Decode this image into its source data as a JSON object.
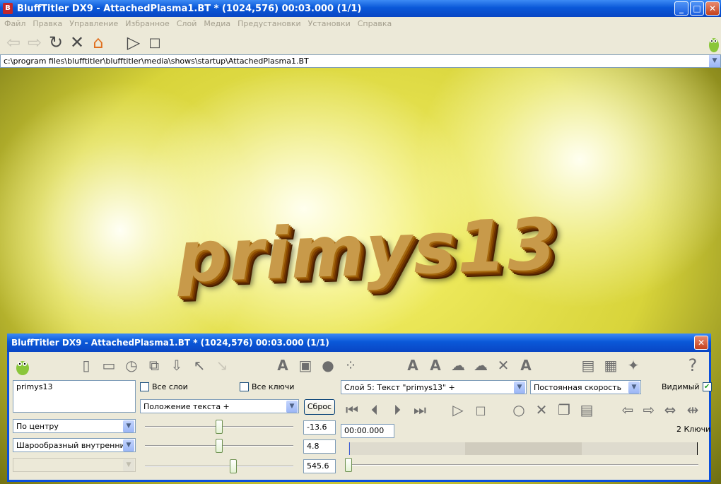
{
  "window": {
    "title": "BluffTitler DX9 - AttachedPlasma1.BT * (1024,576) 00:03.000 (1/1)"
  },
  "menu": [
    "Файл",
    "Правка",
    "Управление",
    "Избранное",
    "Слой",
    "Медиа",
    "Предустановки",
    "Установки",
    "Справка"
  ],
  "path": "c:\\program files\\blufftitler\\blufftitler\\media\\shows\\startup\\AttachedPlasma1.BT",
  "preview": {
    "text": "primys13"
  },
  "panel": {
    "title": "BluffTitler DX9 - AttachedPlasma1.BT * (1024,576) 00:03.000 (1/1)",
    "text_value": "primys13",
    "all_layers_label": "Все слои",
    "all_keys_label": "Все ключи",
    "property_select": "Положение текста +",
    "reset_label": "Сброс",
    "align_select": "По центру",
    "shape_select": "Шарообразный внутренний",
    "value1": "-13.6",
    "value2": "4.8",
    "value3": "545.6",
    "layer_select": "Слой 5: Текст \"primys13\" +",
    "speed_select": "Постоянная скорость",
    "visible_label": "Видимый",
    "time_value": "00:00.000",
    "keys_count": "2 Ключи",
    "slider_fracs": [
      0.5,
      0.5,
      0.6
    ]
  },
  "colors": {
    "titlebar": "#0a58d8",
    "accent_orange": "#e07020"
  }
}
